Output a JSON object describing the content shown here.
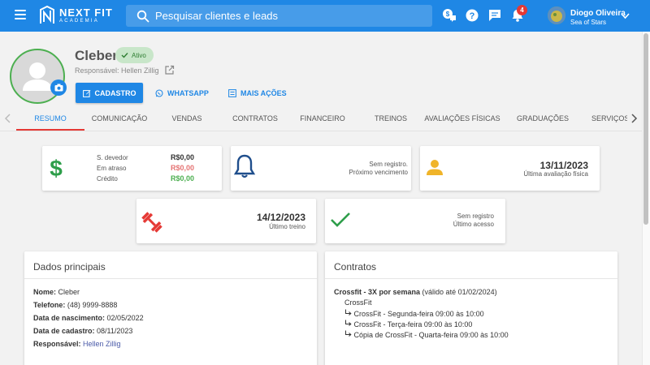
{
  "topbar": {
    "logo_title": "NEXT FIT",
    "logo_subtitle": "ACADEMIA",
    "search_placeholder": "Pesquisar clientes e leads",
    "notification_count": "4",
    "user_name": "Diogo Oliveira",
    "user_org": "Sea of Stars",
    "accent_color": "#1f87e5"
  },
  "profile": {
    "name": "Cleber",
    "status": "Ativo",
    "responsavel": "Responsável: Hellen Zillig",
    "buttons": {
      "cadastro": "CADASTRO",
      "whatsapp": "WHATSAPP",
      "mais_acoes": "MAIS AÇÕES"
    }
  },
  "tabs": [
    "RESUMO",
    "COMUNICAÇÃO",
    "VENDAS",
    "CONTRATOS",
    "FINANCEIRO",
    "TREINOS",
    "AVALIAÇÕES FÍSICAS",
    "GRADUAÇÕES",
    "SERVIÇOS"
  ],
  "cards": {
    "financeiro": {
      "rows": [
        {
          "label": "S. devedor",
          "value": "R$0,00",
          "color": "#333333"
        },
        {
          "label": "Em atraso",
          "value": "R$0,00",
          "color": "#e57373"
        },
        {
          "label": "Crédito",
          "value": "R$0,00",
          "color": "#4caf50"
        }
      ]
    },
    "vencimento": {
      "line1": "Sem registro.",
      "line2": "Próximo vencimento"
    },
    "avaliacao": {
      "date": "13/11/2023",
      "label": "Última avaliação física"
    },
    "treino": {
      "date": "14/12/2023",
      "label": "Último treino"
    },
    "acesso": {
      "line1": "Sem registro",
      "line2": "Último acesso"
    }
  },
  "dados_principais": {
    "title": "Dados principais",
    "rows": [
      {
        "label": "Nome:",
        "value": "Cleber"
      },
      {
        "label": "Telefone:",
        "value": "(48) 9999-8888"
      },
      {
        "label": "Data de nascimento:",
        "value": "02/05/2022"
      },
      {
        "label": "Data de cadastro:",
        "value": "08/11/2023"
      },
      {
        "label": "Responsável:",
        "value": "Hellen Zillig"
      }
    ]
  },
  "contratos": {
    "title": "Contratos",
    "plan_name": "Crossfit - 3X por semana",
    "plan_validity": "(válido até 01/02/2024)",
    "modality": "CrossFit",
    "classes": [
      "CrossFit - Segunda-feira 09:00 às 10:00",
      "CrossFit - Terça-feira 09:00 às 10:00",
      "Cópia de CrossFit - Quarta-feira 09:00 às 10:00"
    ]
  }
}
